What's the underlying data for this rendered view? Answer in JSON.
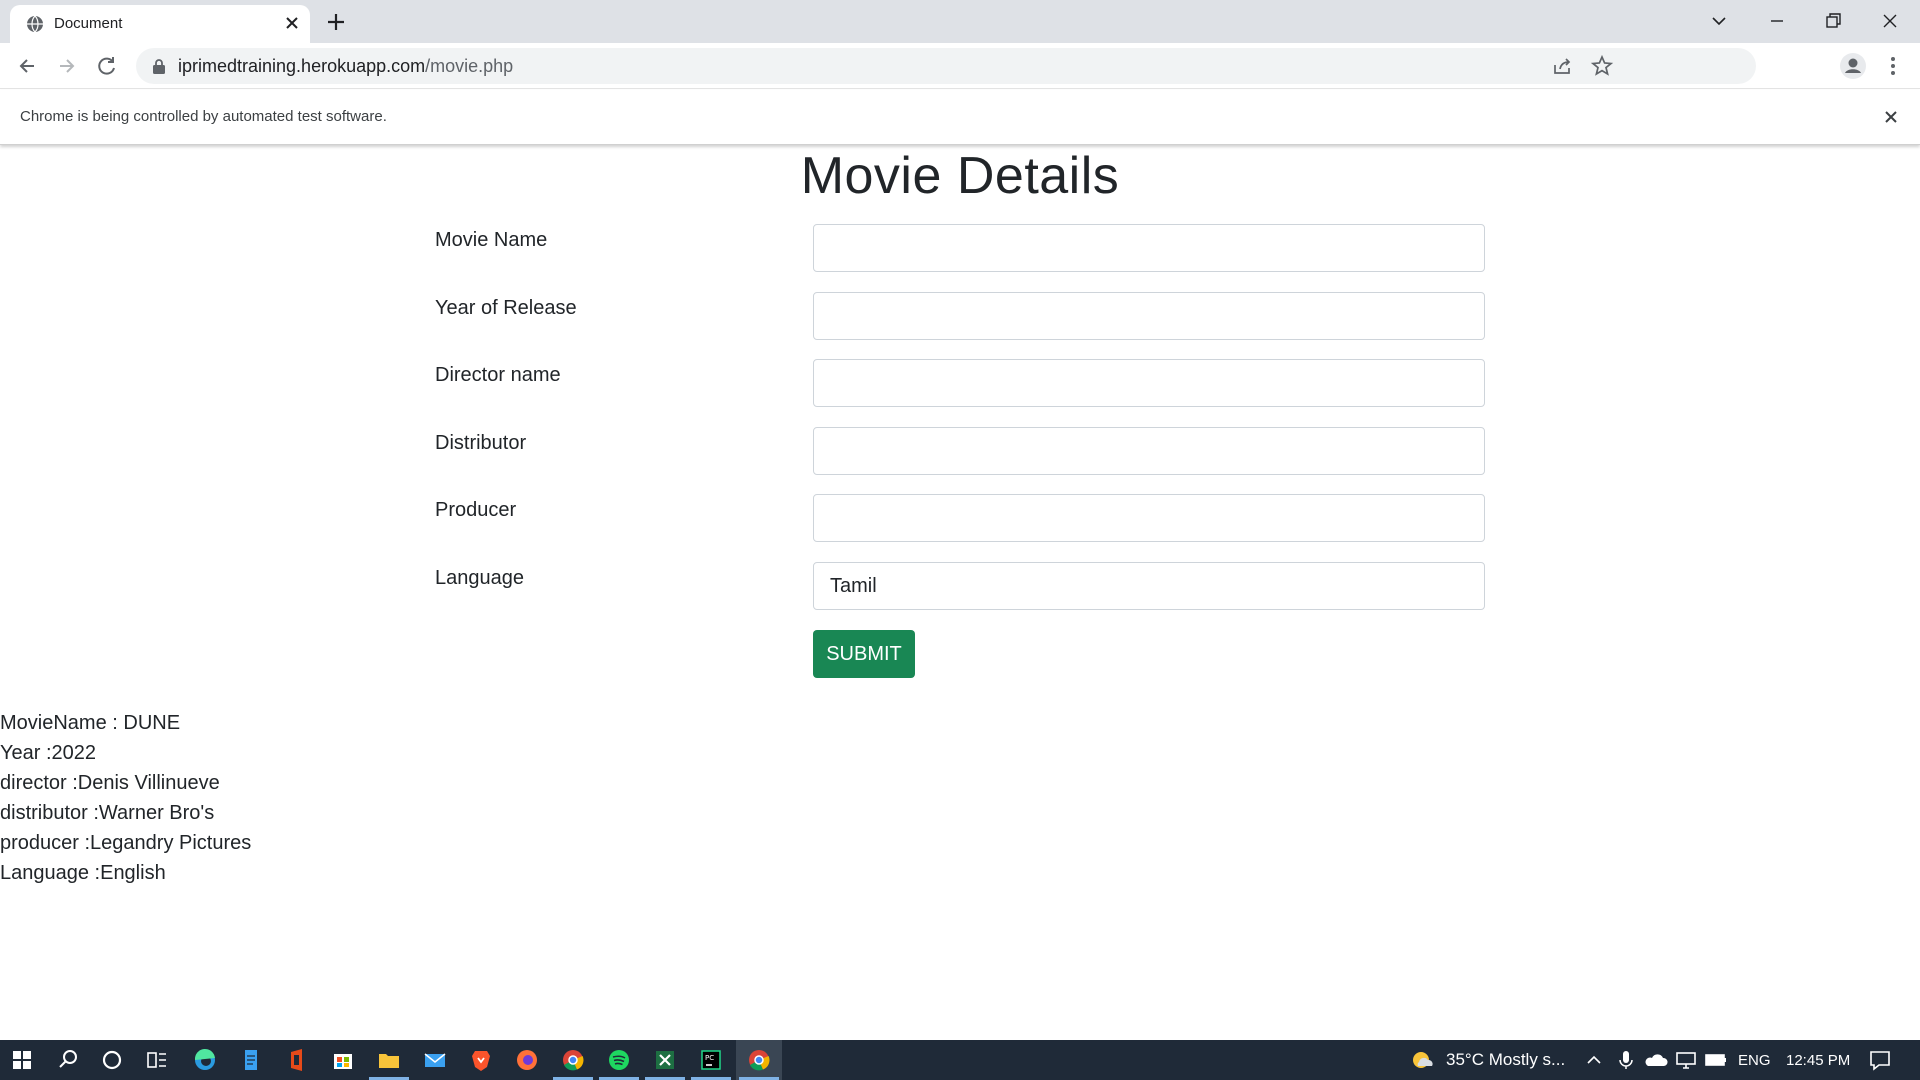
{
  "browser": {
    "tab_title": "Document",
    "url_host": "iprimedtraining.herokuapp.com",
    "url_path": "/movie.php",
    "infobar_text": "Chrome is being controlled by automated test software."
  },
  "page": {
    "title": "Movie Details",
    "fields": [
      {
        "label": "Movie Name",
        "value": ""
      },
      {
        "label": "Year of Release",
        "value": ""
      },
      {
        "label": "Director name",
        "value": ""
      },
      {
        "label": "Distributor",
        "value": ""
      },
      {
        "label": "Producer",
        "value": ""
      },
      {
        "label": "Language",
        "value": "Tamil"
      }
    ],
    "submit_label": "SUBMIT",
    "submit_color": "#198754",
    "results": [
      "MovieName : DUNE",
      "Year :2022",
      "director :Denis Villinueve",
      "distributor :Warner Bro's",
      "producer :Legandry Pictures",
      "Language :English"
    ]
  },
  "taskbar": {
    "weather": "35°C  Mostly s...",
    "language": "ENG",
    "time": "12:45 PM"
  }
}
